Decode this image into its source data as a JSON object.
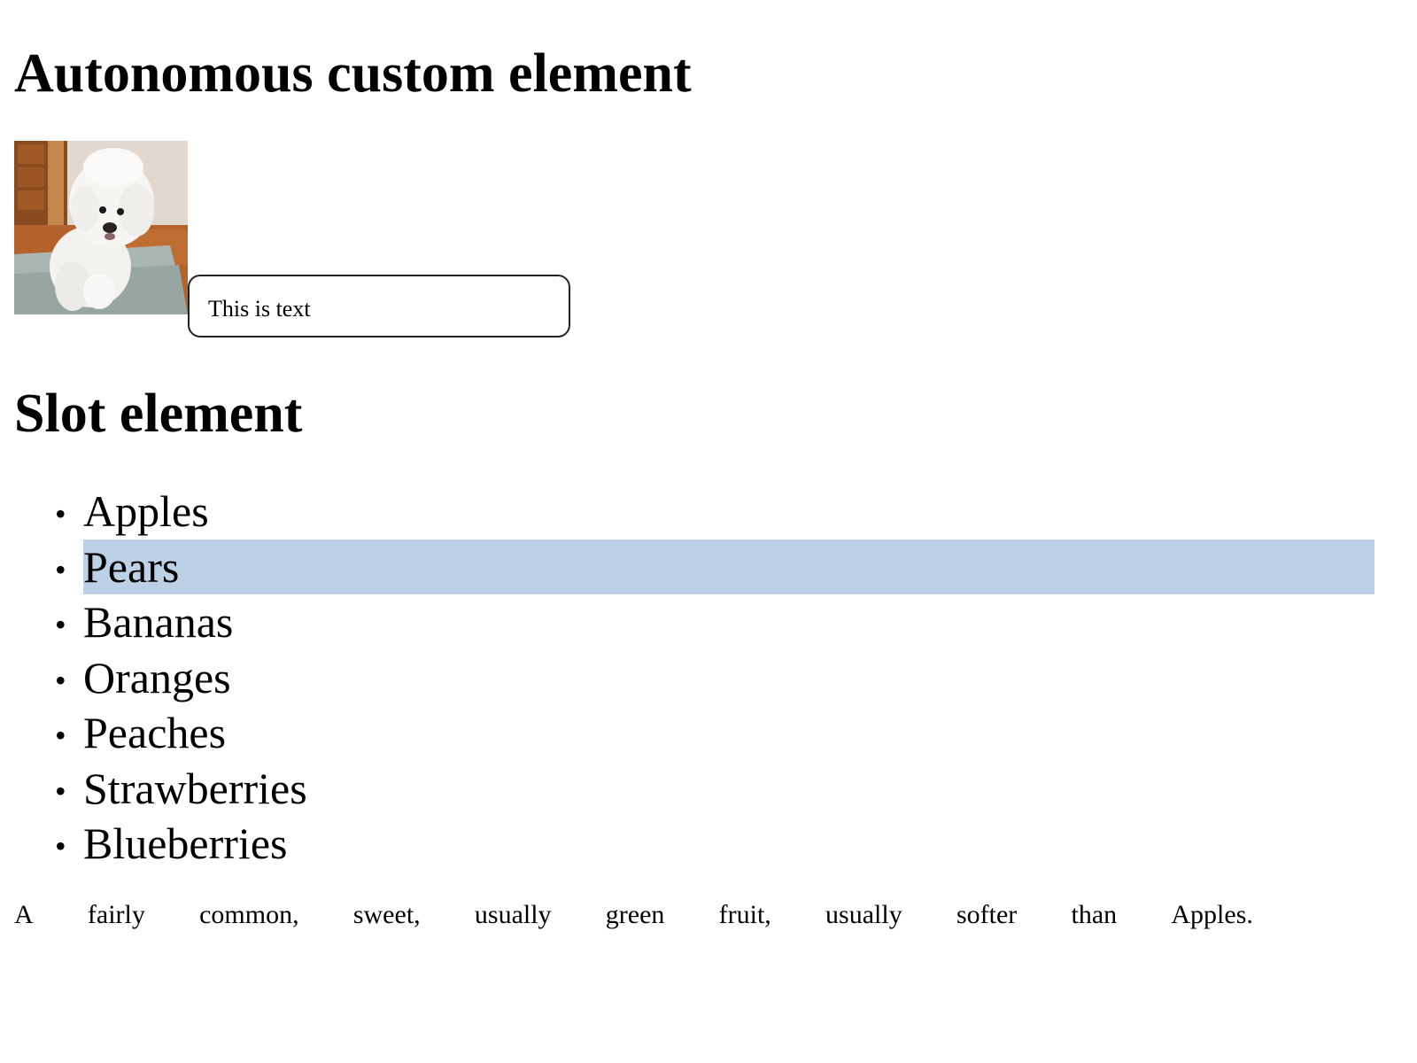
{
  "sections": {
    "autonomous_title": "Autonomous custom element",
    "slot_title": "Slot element"
  },
  "custom_element": {
    "image_icon": "dog-photo",
    "text": "This is text"
  },
  "fruits": [
    {
      "label": "Apples",
      "selected": false
    },
    {
      "label": "Pears",
      "selected": true
    },
    {
      "label": "Bananas",
      "selected": false
    },
    {
      "label": "Oranges",
      "selected": false
    },
    {
      "label": "Peaches",
      "selected": false
    },
    {
      "label": "Strawberries",
      "selected": false
    },
    {
      "label": "Blueberries",
      "selected": false
    }
  ],
  "bullet": "•",
  "description": {
    "words": [
      "A",
      "fairly",
      "common,",
      "sweet,",
      "usually",
      "green",
      "fruit,",
      "usually",
      "softer",
      "than",
      "Apples."
    ]
  },
  "colors": {
    "selection": "#bcd1e6",
    "text": "#000000",
    "border": "#222222"
  }
}
